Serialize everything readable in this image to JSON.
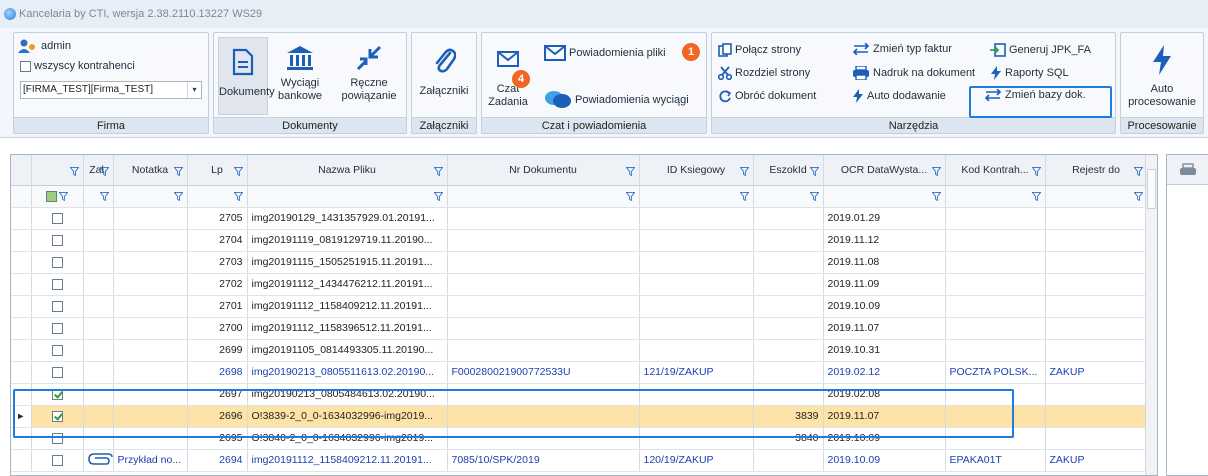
{
  "window": {
    "title": "Kancelaria by CTI, wersja  2.38.2110.13227 WS29"
  },
  "ribbon": {
    "firma": {
      "user": "admin",
      "all_contractors_label": "wszyscy kontrahenci",
      "company_value": "[FIRMA_TEST][Firma_TEST]",
      "group_label": "Firma"
    },
    "dokumenty": {
      "dokumenty_label": "Dokumenty",
      "wyciagi_label": "Wyciągi bankowe",
      "reczne_label": "Ręczne powiązanie",
      "group_label": "Dokumenty"
    },
    "zalaczniki": {
      "button_label": "Załączniki",
      "group_label": "Załączniki"
    },
    "czat": {
      "czat_label": "Czat",
      "zadania_label": "Zadania",
      "zadania_badge": "4",
      "powiadomienia_pliki": "Powiadomienia pliki",
      "powiadomienia_pliki_badge": "1",
      "powiadomienia_wyciagi": "Powiadomienia wyciągi",
      "group_label": "Czat i powiadomienia"
    },
    "narzedzia": {
      "polacz": "Połącz strony",
      "rozdziel": "Rozdziel strony",
      "obroc": "Obróć dokument",
      "zmien_typ": "Zmień typ faktur",
      "nadruk": "Nadruk na dokument",
      "auto_dodawanie": "Auto dodawanie",
      "generuj": "Generuj JPK_FA",
      "raporty": "Raporty SQL",
      "zmien_bazy": "Zmień bazy dok.",
      "group_label": "Narzędzia"
    },
    "procesowanie": {
      "button_label": "Auto procesowanie",
      "group_label": "Procesowanie"
    }
  },
  "grid": {
    "columns": [
      "",
      "Zał.",
      "Notatka",
      "Lp",
      "Nazwa Pliku",
      "Nr Dokumentu",
      "ID Ksiegowy",
      "EszokId",
      "OCR DataWysta...",
      "Kod Kontrah...",
      "Rejestr do"
    ],
    "rows": [
      {
        "checked": false,
        "zal": "",
        "notatka": "",
        "lp": "2705",
        "nazwa": "img20190129_1431357929.01.20191...",
        "nr": "",
        "idk": "",
        "eszok": "",
        "data": "2019.01.29",
        "kod": "",
        "rej": "",
        "style": ""
      },
      {
        "checked": false,
        "zal": "",
        "notatka": "",
        "lp": "2704",
        "nazwa": "img20191119_0819129719.11.20190...",
        "nr": "",
        "idk": "",
        "eszok": "",
        "data": "2019.11.12",
        "kod": "",
        "rej": "",
        "style": ""
      },
      {
        "checked": false,
        "zal": "",
        "notatka": "",
        "lp": "2703",
        "nazwa": "img20191115_1505251915.11.20191...",
        "nr": "",
        "idk": "",
        "eszok": "",
        "data": "2019.11.08",
        "kod": "",
        "rej": "",
        "style": ""
      },
      {
        "checked": false,
        "zal": "",
        "notatka": "",
        "lp": "2702",
        "nazwa": "img20191112_1434476212.11.20191...",
        "nr": "",
        "idk": "",
        "eszok": "",
        "data": "2019.11.09",
        "kod": "",
        "rej": "",
        "style": ""
      },
      {
        "checked": false,
        "zal": "",
        "notatka": "",
        "lp": "2701",
        "nazwa": "img20191112_1158409212.11.20191...",
        "nr": "",
        "idk": "",
        "eszok": "",
        "data": "2019.10.09",
        "kod": "",
        "rej": "",
        "style": ""
      },
      {
        "checked": false,
        "zal": "",
        "notatka": "",
        "lp": "2700",
        "nazwa": "img20191112_1158396512.11.20191...",
        "nr": "",
        "idk": "",
        "eszok": "",
        "data": "2019.11.07",
        "kod": "",
        "rej": "",
        "style": ""
      },
      {
        "checked": false,
        "zal": "",
        "notatka": "",
        "lp": "2699",
        "nazwa": "img20191105_0814493305.11.20190...",
        "nr": "",
        "idk": "",
        "eszok": "",
        "data": "2019.10.31",
        "kod": "",
        "rej": "",
        "style": ""
      },
      {
        "checked": false,
        "zal": "",
        "notatka": "",
        "lp": "2698",
        "nazwa": "img20190213_0805511613.02.20190...",
        "nr": "F000280021900772533U",
        "idk": "121/19/ZAKUP",
        "eszok": "",
        "data": "2019.02.12",
        "kod": "POCZTA POLSK...",
        "rej": "ZAKUP",
        "style": "blue"
      },
      {
        "checked": true,
        "zal": "",
        "notatka": "",
        "lp": "2697",
        "nazwa": "img20190213_0805484613.02.20190...",
        "nr": "",
        "idk": "",
        "eszok": "",
        "data": "2019.02.08",
        "kod": "",
        "rej": "",
        "style": ""
      },
      {
        "checked": true,
        "zal": "",
        "notatka": "",
        "lp": "2696",
        "nazwa": "O!3839-2_0_0-1634032996-img2019...",
        "nr": "",
        "idk": "",
        "eszok": "3839",
        "data": "2019.11.07",
        "kod": "",
        "rej": "",
        "style": "sel"
      },
      {
        "checked": false,
        "zal": "",
        "notatka": "",
        "lp": "2695",
        "nazwa": "O!3840-2_0_0-1634032996-img2019...",
        "nr": "",
        "idk": "",
        "eszok": "3840",
        "data": "2019.10.09",
        "kod": "",
        "rej": "",
        "style": ""
      },
      {
        "checked": false,
        "zal": "clip",
        "notatka": "Przykład no...",
        "lp": "2694",
        "nazwa": "img20191112_1158409212.11.20191...",
        "nr": "7085/10/SPK/2019",
        "idk": "120/19/ZAKUP",
        "eszok": "",
        "data": "2019.10.09",
        "kod": "EPAKA01T",
        "rej": "ZAKUP",
        "style": "blue"
      }
    ]
  },
  "colors": {
    "accent": "#1e7be0",
    "selected_row": "#fde3a7",
    "link_blue": "#1a3fb0",
    "badge": "#f26522"
  }
}
